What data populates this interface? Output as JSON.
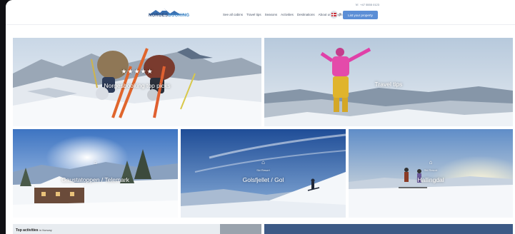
{
  "header": {
    "phone": "+47 5555 0123",
    "logo": {
      "part1": "NORGES",
      "part2": "BOOKING"
    },
    "nav": [
      "See all cabins",
      "Travel tips",
      "Seasons",
      "Activities",
      "Destinations",
      "About us",
      "Login"
    ],
    "list_button": "List your property"
  },
  "tiles": {
    "top_picks": {
      "label": "Norgesbooking top picks",
      "stars": "★★★★★"
    },
    "travel_tips": {
      "label": "Travel tips"
    },
    "gaustatoppen": {
      "label": "Gaustatoppen / Telemark"
    },
    "golsfjellet": {
      "label": "Golsfjellet / Gol",
      "sub": "Ski Resort"
    },
    "hallingdal": {
      "label": "Hallingdal",
      "sub": "Ski Resort"
    }
  },
  "bottom": {
    "title": "Top activities",
    "subtitle": "in Norway"
  },
  "colors": {
    "accent": "#5b8ed6",
    "brand": "#2b4a78"
  }
}
